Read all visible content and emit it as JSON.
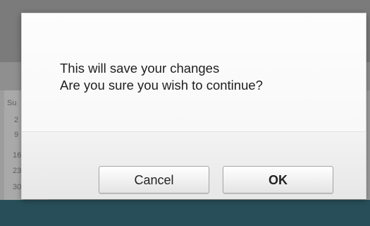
{
  "dialog": {
    "message_line1": "This will save your changes",
    "message_line2": "Are you sure you wish to continue?",
    "cancel_label": "Cancel",
    "ok_label": "OK"
  },
  "background": {
    "calendar_cells": [
      "Su",
      "2",
      "9",
      "16",
      "23",
      "30"
    ]
  },
  "colors": {
    "footer_bar": "#284f59",
    "dialog_background": "#f8f8f8"
  }
}
